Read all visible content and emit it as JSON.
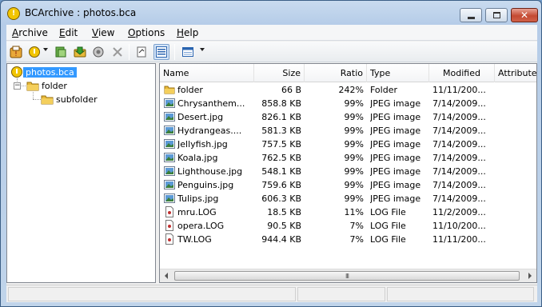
{
  "window": {
    "title": "BCArchive : photos.bca",
    "app_icon_glyph": "!",
    "close_glyph": "✕"
  },
  "menu": [
    "Archive",
    "Edit",
    "View",
    "Options",
    "Help"
  ],
  "toolbar": {
    "icons": [
      "open-archive-icon",
      "new-archive-icon",
      "add-files-icon",
      "extract-icon",
      "test-icon",
      "delete-icon",
      "properties-icon",
      "details-view-icon",
      "view-mode-icon"
    ]
  },
  "tree": {
    "root": "photos.bca",
    "child": "folder",
    "grandchild": "subfolder",
    "expander_glyph": "−"
  },
  "columns": [
    "Name",
    "Size",
    "Ratio",
    "Type",
    "Modified",
    "Attributes"
  ],
  "files": [
    {
      "name": "folder",
      "size": "66 B",
      "ratio": "242%",
      "type": "Folder",
      "modified": "11/11/200...",
      "kind": "folder"
    },
    {
      "name": "Chrysanthem...",
      "size": "858.8 KB",
      "ratio": "99%",
      "type": "JPEG image",
      "modified": "7/14/2009...",
      "kind": "image"
    },
    {
      "name": "Desert.jpg",
      "size": "826.1 KB",
      "ratio": "99%",
      "type": "JPEG image",
      "modified": "7/14/2009...",
      "kind": "image"
    },
    {
      "name": "Hydrangeas....",
      "size": "581.3 KB",
      "ratio": "99%",
      "type": "JPEG image",
      "modified": "7/14/2009...",
      "kind": "image"
    },
    {
      "name": "Jellyfish.jpg",
      "size": "757.5 KB",
      "ratio": "99%",
      "type": "JPEG image",
      "modified": "7/14/2009...",
      "kind": "image"
    },
    {
      "name": "Koala.jpg",
      "size": "762.5 KB",
      "ratio": "99%",
      "type": "JPEG image",
      "modified": "7/14/2009...",
      "kind": "image"
    },
    {
      "name": "Lighthouse.jpg",
      "size": "548.1 KB",
      "ratio": "99%",
      "type": "JPEG image",
      "modified": "7/14/2009...",
      "kind": "image"
    },
    {
      "name": "Penguins.jpg",
      "size": "759.6 KB",
      "ratio": "99%",
      "type": "JPEG image",
      "modified": "7/14/2009...",
      "kind": "image"
    },
    {
      "name": "Tulips.jpg",
      "size": "606.3 KB",
      "ratio": "99%",
      "type": "JPEG image",
      "modified": "7/14/2009...",
      "kind": "image"
    },
    {
      "name": "mru.LOG",
      "size": "18.5 KB",
      "ratio": "11%",
      "type": "LOG File",
      "modified": "11/2/2009...",
      "kind": "log"
    },
    {
      "name": "opera.LOG",
      "size": "90.5 KB",
      "ratio": "7%",
      "type": "LOG File",
      "modified": "11/10/200...",
      "kind": "log"
    },
    {
      "name": "TW.LOG",
      "size": "944.4 KB",
      "ratio": "7%",
      "type": "LOG File",
      "modified": "11/11/200...",
      "kind": "log"
    }
  ],
  "scrollbar_grip": "III",
  "colors": {
    "selection": "#3399ff",
    "folder": "#e8b93a",
    "titlebar": "#b5cce8"
  }
}
